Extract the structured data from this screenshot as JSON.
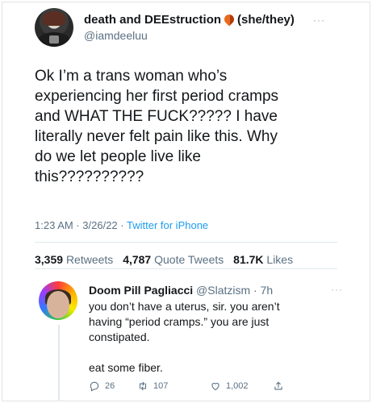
{
  "tweet": {
    "display_name": "death and DEEstruction",
    "pronouns": "(she/they)",
    "handle": "@iamdeeluu",
    "more": "···",
    "text": "Ok I’m a trans woman who’s\nexperiencing her first period cramps\nand WHAT THE FUCK????? I have\nliterally never felt pain like this. Why\ndo we let people live like\nthis??????????",
    "time": "1:23 AM",
    "date": "3/26/22",
    "source": "Twitter for iPhone",
    "retweets_count": "3,359",
    "retweets_label": "Retweets",
    "quotes_count": "4,787",
    "quotes_label": "Quote Tweets",
    "likes_count": "81.7K",
    "likes_label": "Likes"
  },
  "reply": {
    "display_name": "Doom Pill Pagliacci",
    "handle": "@Slatzism",
    "age": "7h",
    "more": "···",
    "text": "you don’t have a uterus, sir. you aren’t\nhaving “period cramps.” you are just\nconstipated.\n\neat some fiber.",
    "reply_count": "26",
    "retweet_count": "107",
    "like_count": "1,002"
  },
  "icons": {
    "emoji": "orange-flame-emoji-icon",
    "reply": "reply-icon",
    "retweet": "retweet-icon",
    "like": "heart-icon",
    "share": "share-icon"
  },
  "colors": {
    "link": "#1d9bf0",
    "secondary_text": "#5b7083"
  }
}
